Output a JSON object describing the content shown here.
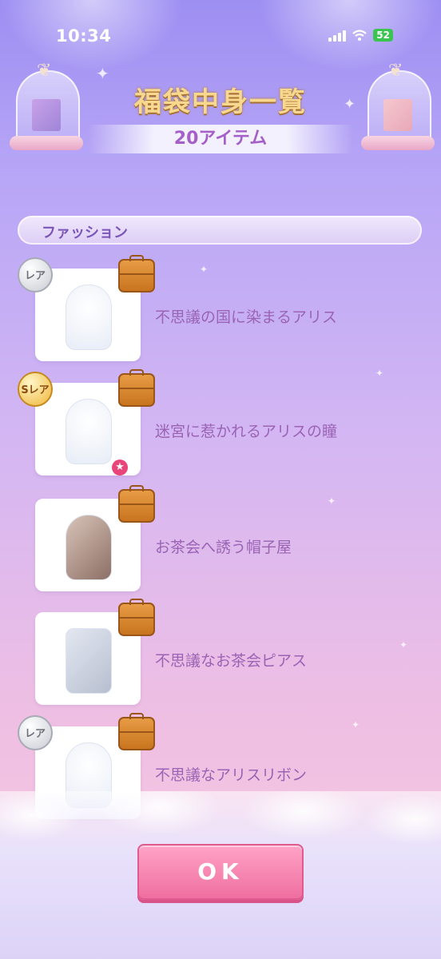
{
  "status_bar": {
    "time": "10:34",
    "battery": "52"
  },
  "header": {
    "title": "福袋中身一覧",
    "count": "20アイテム"
  },
  "category": {
    "label": "ファッション"
  },
  "items": [
    {
      "name": "不思議の国に染まるアリス",
      "rarity": "レア"
    },
    {
      "name": "迷宮に惹かれるアリスの瞳",
      "rarity": "Sレア"
    },
    {
      "name": "お茶会へ誘う帽子屋",
      "rarity": ""
    },
    {
      "name": "不思議なお茶会ピアス",
      "rarity": ""
    },
    {
      "name": "不思議なアリスリボン",
      "rarity": "レア"
    }
  ],
  "footer": {
    "ok_label": "OK"
  }
}
